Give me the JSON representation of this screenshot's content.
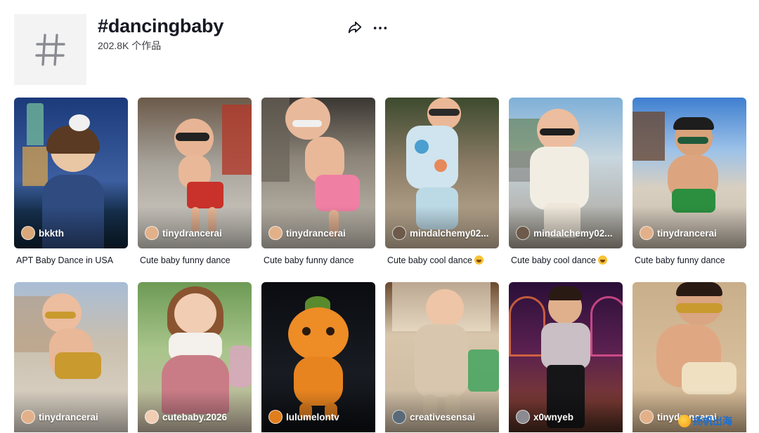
{
  "header": {
    "title": "#dancingbaby",
    "count": "202.8K 个作品",
    "share_icon": "share-icon",
    "more_icon": "more-icon",
    "hashtag_icon": "hashtag-icon"
  },
  "videos": [
    {
      "author": "bkkth",
      "caption": "APT Baby Dance in USA",
      "bg": "#1c3c78"
    },
    {
      "author": "tinydrancerai",
      "caption": "Cute baby funny dance",
      "bg": "#8b6f52"
    },
    {
      "author": "tinydrancerai",
      "caption": "Cute baby funny dance",
      "bg": "#a69b8c"
    },
    {
      "author": "mindalchemy02...",
      "caption": "Cute baby cool dance",
      "bg": "#8e7d68",
      "emoji": "laughing-emoji"
    },
    {
      "author": "mindalchemy02...",
      "caption": "Cute baby cool dance",
      "bg": "#9aa5ae",
      "emoji": "laughing-emoji"
    },
    {
      "author": "tinydrancerai",
      "caption": "Cute baby funny dance",
      "bg": "#5f8fc9"
    },
    {
      "author": "tinydrancerai",
      "bg": "#b9a893"
    },
    {
      "author": "cutebaby.2026",
      "bg": "#7fa96a"
    },
    {
      "author": "lulumelontv",
      "bg": "#111418"
    },
    {
      "author": "creativesensai",
      "bg": "#c7b49c"
    },
    {
      "author": "x0wnyeb",
      "bg": "#3a1a3c"
    },
    {
      "author": "tinydrancerai",
      "bg": "#cfb493"
    }
  ],
  "watermark": {
    "text": "扬帆出海"
  }
}
